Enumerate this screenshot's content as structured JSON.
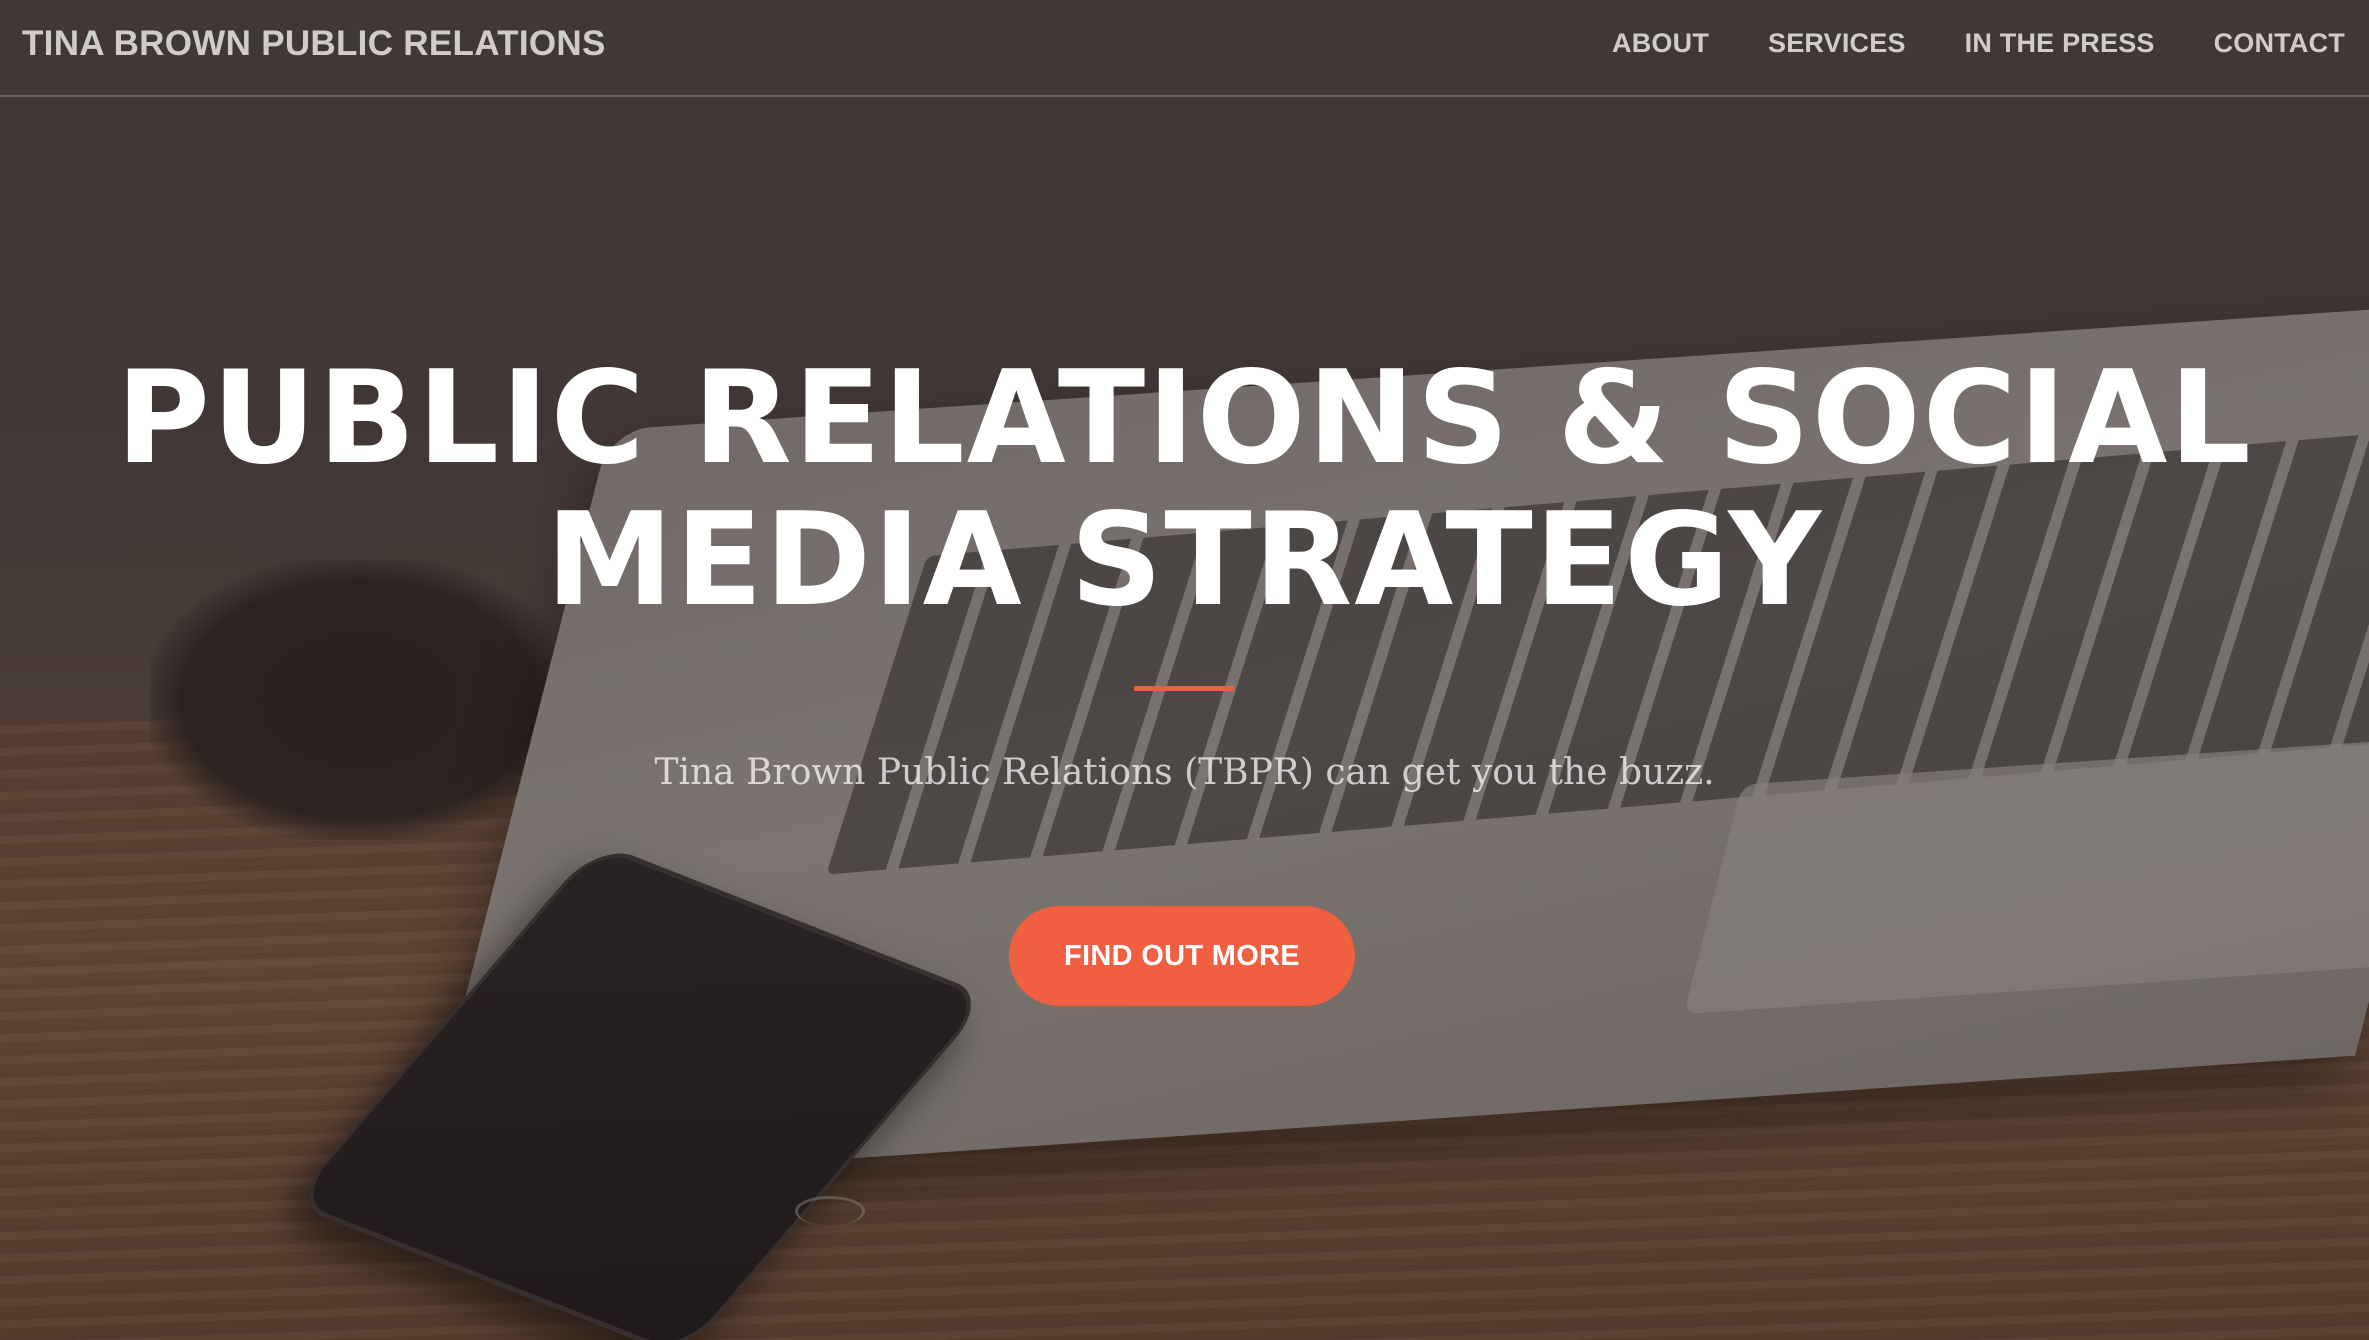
{
  "navbar": {
    "brand": "TINA BROWN PUBLIC RELATIONS",
    "links": [
      "ABOUT",
      "SERVICES",
      "IN THE PRESS",
      "CONTACT"
    ]
  },
  "hero": {
    "headline_line1": "PUBLIC RELATIONS & SOCIAL",
    "headline_line2": "MEDIA STRATEGY",
    "tagline": "Tina Brown Public Relations (TBPR) can get you the buzz.",
    "cta_label": "FIND OUT MORE"
  },
  "colors": {
    "accent": "#f05f40",
    "text": "#ffffff"
  }
}
